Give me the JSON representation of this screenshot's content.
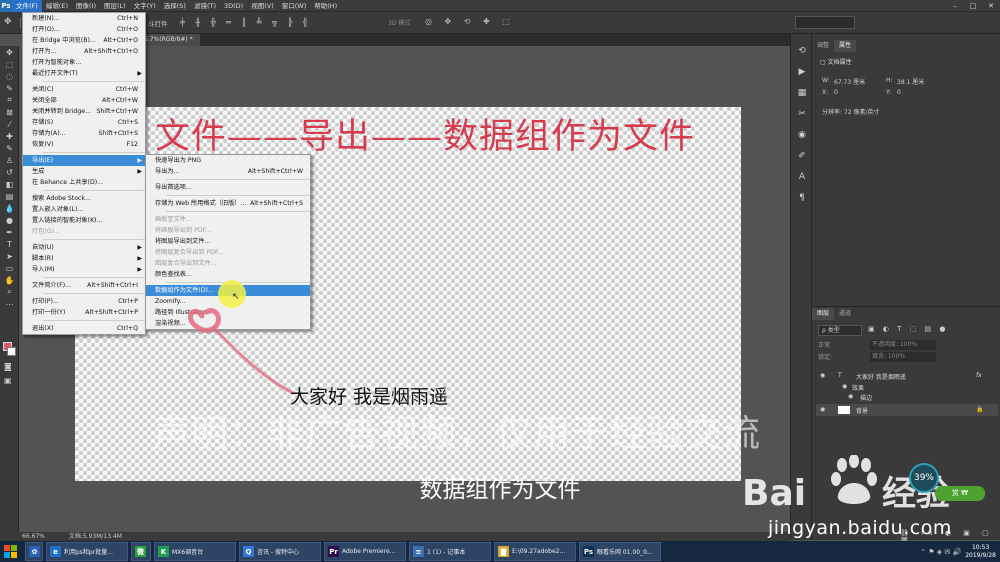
{
  "app": {
    "logo": "Ps"
  },
  "menubar": {
    "items": [
      "文件(F)",
      "编辑(E)",
      "图像(I)",
      "图层(L)",
      "文字(Y)",
      "选择(S)",
      "滤镜(T)",
      "3D(D)",
      "视图(V)",
      "窗口(W)",
      "帮助(H)"
    ],
    "active_index": 0
  },
  "options_bar": {
    "label": "斗打件",
    "search_label": "3D 模式"
  },
  "document_tab": {
    "title": "6.7%(RGB/8#) *"
  },
  "file_menu": {
    "items": [
      {
        "label": "新建(N)...",
        "shortcut": "Ctrl+N"
      },
      {
        "label": "打开(O)...",
        "shortcut": "Ctrl+O"
      },
      {
        "label": "在 Bridge 中浏览(B)...",
        "shortcut": "Alt+Ctrl+O"
      },
      {
        "label": "打开为...",
        "shortcut": "Alt+Shift+Ctrl+O"
      },
      {
        "label": "打开为智能对象...",
        "shortcut": ""
      },
      {
        "label": "最近打开文件(T)",
        "shortcut": "",
        "submenu": true
      },
      {
        "sep": true
      },
      {
        "label": "关闭(C)",
        "shortcut": "Ctrl+W"
      },
      {
        "label": "关闭全部",
        "shortcut": "Alt+Ctrl+W"
      },
      {
        "label": "关闭并转到 Bridge...",
        "shortcut": "Shift+Ctrl+W"
      },
      {
        "label": "存储(S)",
        "shortcut": "Ctrl+S"
      },
      {
        "label": "存储为(A)...",
        "shortcut": "Shift+Ctrl+S"
      },
      {
        "label": "恢复(V)",
        "shortcut": "F12"
      },
      {
        "sep": true
      },
      {
        "label": "导出(E)",
        "shortcut": "",
        "submenu": true,
        "highlight": true
      },
      {
        "label": "生成",
        "shortcut": "",
        "submenu": true
      },
      {
        "label": "在 Behance 上共享(D)...",
        "shortcut": ""
      },
      {
        "sep": true
      },
      {
        "label": "搜索 Adobe Stock...",
        "shortcut": ""
      },
      {
        "label": "置入嵌入对象(L)...",
        "shortcut": ""
      },
      {
        "label": "置入链接的智能对象(K)...",
        "shortcut": ""
      },
      {
        "label": "打包(G)...",
        "shortcut": "",
        "disabled": true
      },
      {
        "sep": true
      },
      {
        "label": "自动(U)",
        "shortcut": "",
        "submenu": true
      },
      {
        "label": "脚本(R)",
        "shortcut": "",
        "submenu": true
      },
      {
        "label": "导入(M)",
        "shortcut": "",
        "submenu": true
      },
      {
        "sep": true
      },
      {
        "label": "文件简介(F)...",
        "shortcut": "Alt+Shift+Ctrl+I"
      },
      {
        "sep": true
      },
      {
        "label": "打印(P)...",
        "shortcut": "Ctrl+P"
      },
      {
        "label": "打印一份(Y)",
        "shortcut": "Alt+Shift+Ctrl+P"
      },
      {
        "sep": true
      },
      {
        "label": "退出(X)",
        "shortcut": "Ctrl+Q"
      }
    ]
  },
  "export_menu": {
    "items": [
      {
        "label": "快速导出为 PNG",
        "shortcut": ""
      },
      {
        "label": "导出为...",
        "shortcut": "Alt+Shift+Ctrl+W"
      },
      {
        "sep": true
      },
      {
        "label": "导出首选项...",
        "shortcut": ""
      },
      {
        "sep": true
      },
      {
        "label": "存储为 Web 所用格式（旧版）...",
        "shortcut": "Alt+Shift+Ctrl+S"
      },
      {
        "sep": true
      },
      {
        "label": "画板至文件...",
        "shortcut": "",
        "disabled": true
      },
      {
        "label": "将画板导出到 PDF...",
        "shortcut": "",
        "disabled": true
      },
      {
        "label": "将图层导出到文件...",
        "shortcut": ""
      },
      {
        "label": "将图层复合导出到 PDF...",
        "shortcut": "",
        "disabled": true
      },
      {
        "label": "图层复合导出到文件...",
        "shortcut": "",
        "disabled": true
      },
      {
        "label": "颜色查找表...",
        "shortcut": ""
      },
      {
        "sep": true
      },
      {
        "label": "数据组作为文件(D)...",
        "shortcut": "",
        "highlight": true
      },
      {
        "label": "Zoomify...",
        "shortcut": ""
      },
      {
        "label": "路径到 Illustrator...",
        "shortcut": ""
      },
      {
        "label": "渲染视频...",
        "shortcut": ""
      }
    ]
  },
  "canvas": {
    "title_text": "文件——导出——数据组作为文件"
  },
  "properties_panel": {
    "tabs": [
      "调整",
      "属性"
    ],
    "active_tab": 1,
    "section": "文档属性",
    "w_label": "W:",
    "w_value": "67.73 厘米",
    "h_label": "H:",
    "h_value": "38.1 厘米",
    "x_label": "X:",
    "x_value": "0",
    "y_label": "Y:",
    "y_value": "0",
    "resolution": "分辨率: 72 像素/英寸"
  },
  "layers_panel": {
    "tabs": [
      "图层",
      "通道"
    ],
    "active_tab": 0,
    "kind_label": "ρ 类型",
    "blend_mode": "正常",
    "opacity_label": "不透明度: 100%",
    "lock_label": "锁定:",
    "fill_label": "填充: 100%",
    "layers": [
      {
        "name": "大家好 我是烟雨遥",
        "type": "T",
        "fx": "fx"
      },
      {
        "name": "效果",
        "type": ""
      },
      {
        "name": "描边",
        "type": ""
      },
      {
        "name": "背景",
        "type": ""
      }
    ]
  },
  "status_bar": {
    "zoom": "66.67%",
    "doc_size": "文档:5.93M/13.4M"
  },
  "overlay": {
    "caption": "大家好  我是烟雨遥",
    "watermark": "声明：非广告视频，仅用于经验交流",
    "subtitle": "数据组作为文件",
    "baidu_logo_text": "Baidu经验",
    "baidu_url": "jingyan.baidu.com",
    "circle_value": "39%",
    "badge_text": "赏 ₩"
  },
  "taskbar": {
    "buttons": [
      {
        "label": "利用ps和pr批量...",
        "icon": "e"
      },
      {
        "label": "",
        "icon": "微"
      },
      {
        "label": "MX6调音台",
        "icon": "K"
      },
      {
        "label": "咨讯 - 搜特中心",
        "icon": "Q"
      },
      {
        "label": "Adobe Premiere...",
        "icon": "Pr"
      },
      {
        "label": "1 (1) - 记事本",
        "icon": "≡"
      },
      {
        "label": "E:\\09.27adobe2...",
        "icon": "▇"
      },
      {
        "label": "眼看乐网 01.00_0...",
        "icon": "Ps"
      }
    ],
    "time": "10:53",
    "date": "2019/9/28"
  }
}
